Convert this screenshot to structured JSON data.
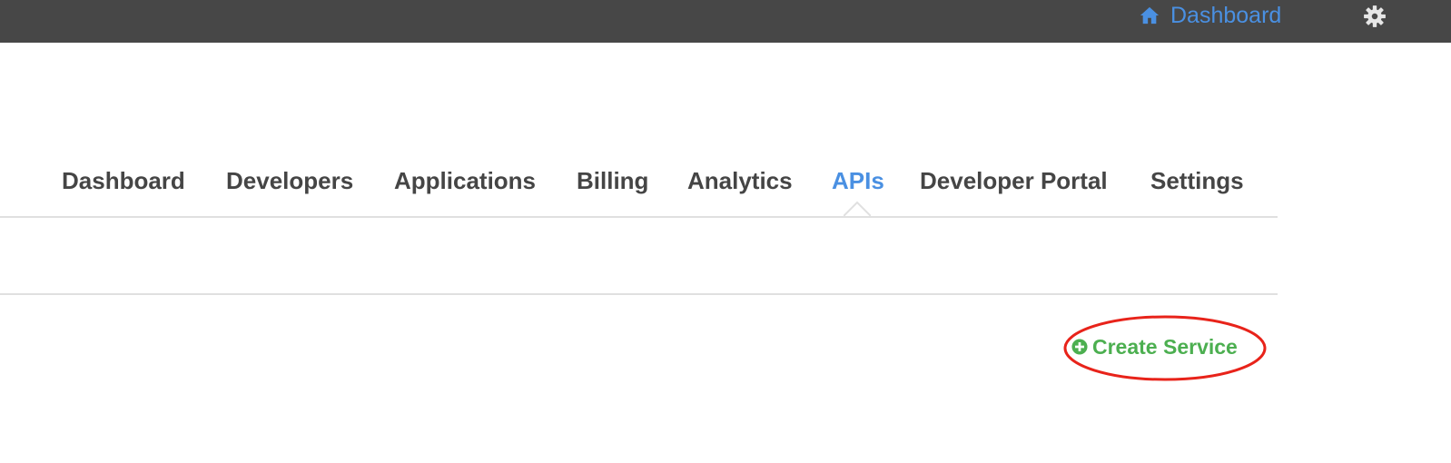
{
  "topbar": {
    "dashboard_label": "Dashboard",
    "icons": {
      "home": "home-icon",
      "settings": "gear-icon"
    },
    "colors": {
      "background": "#474747",
      "link": "#4a90e2",
      "gear": "#e6e6e6"
    }
  },
  "nav": {
    "items": [
      {
        "label": "Dashboard",
        "active": false
      },
      {
        "label": "Developers",
        "active": false
      },
      {
        "label": "Applications",
        "active": false
      },
      {
        "label": "Billing",
        "active": false
      },
      {
        "label": "Analytics",
        "active": false
      },
      {
        "label": "APIs",
        "active": true
      },
      {
        "label": "Developer Portal",
        "active": false
      },
      {
        "label": "Settings",
        "active": false
      }
    ],
    "colors": {
      "text": "#454545",
      "active": "#4a90e2",
      "border": "#e0e0e0"
    }
  },
  "actions": {
    "create_service_label": "Create Service",
    "icon": "plus-circle-icon",
    "color": "#4caf50",
    "highlight_color": "#e8231a"
  }
}
